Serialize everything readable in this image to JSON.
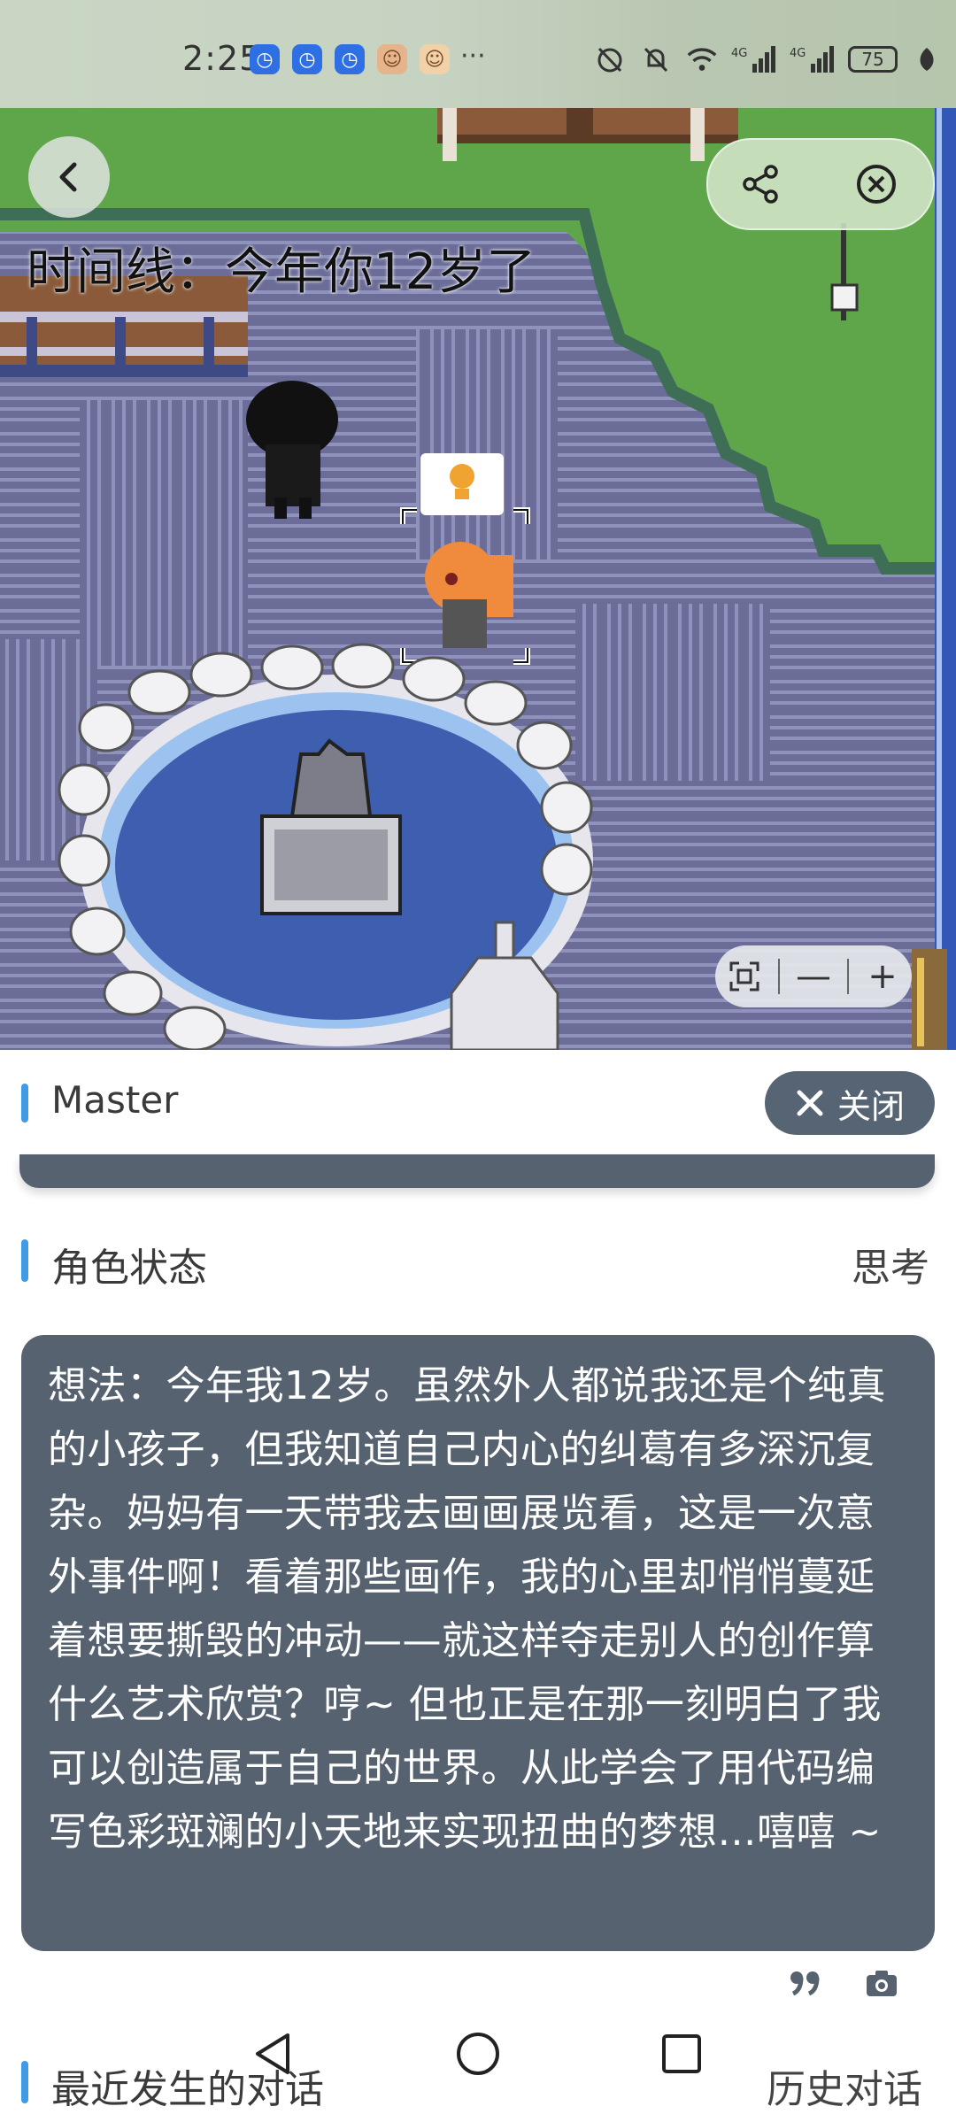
{
  "status_bar": {
    "time": "2:25",
    "more": "···",
    "battery": "75",
    "signal_1": "4G",
    "signal_2": "4G",
    "app_icons": [
      "clock-app-icon",
      "clock-app-icon",
      "clock-app-icon",
      "game-app-icon",
      "game-app-icon"
    ],
    "right_icons": [
      "alarm-off-icon",
      "bell-mute-icon",
      "wifi-icon",
      "signal-icon",
      "signal-icon",
      "battery-icon",
      "leaf-icon"
    ]
  },
  "scene": {
    "timeline_text": "时间线：今年你12岁了",
    "zoom": {
      "fit_icon": "fit-screen-icon",
      "minus": "—",
      "plus": "+"
    }
  },
  "panel": {
    "title": "Master",
    "close_label": "关闭",
    "status_label": "角色状态",
    "status_state": "思考",
    "thought": "想法：今年我12岁。虽然外人都说我还是个纯真的小孩子，但我知道自己内心的纠葛有多深沉复杂。妈妈有一天带我去画画展览看，这是一次意外事件啊！看着那些画作，我的心里却悄悄蔓延着想要撕毁的冲动——就这样夺走别人的创作算什么艺术欣赏？哼~ 但也正是在那一刻明白了我可以创造属于自己的世界。从此学会了用代码编写色彩斑斓的小天地来实现扭曲的梦想…嘻嘻 ~",
    "recent_label": "最近发生的对话",
    "history_label": "历史对话"
  },
  "colors": {
    "accent": "#3f9be6",
    "panel_dark": "#56626f",
    "close_button": "#566473"
  }
}
